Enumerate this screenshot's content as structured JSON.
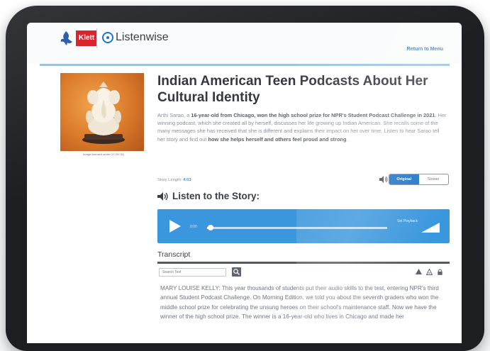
{
  "header": {
    "klett_logo_text": "Klett",
    "listenwise_logo_text": "Listenwise",
    "return_link": "Return to Menu"
  },
  "thumbnail": {
    "caption": "Image licensed under CC BY-SA"
  },
  "story": {
    "title": "Indian American Teen Podcasts About Her Cultural Identity",
    "body_parts": [
      "Arthi Sarao, a ",
      "16-year-old from Chicago, won the high school prize for NPR's Student Podcast Challenge in 2021",
      ". Her winning podcast, which she created all by herself, discusses her life growing up Indian American. She recalls some of the many messages she has received that she is different and explains their impact on her over time. Listen to hear Sarao tell her story and find out ",
      "how she helps herself and others feel proud and strong",
      "."
    ],
    "length_label": "Story Length: ",
    "length_value": "4:03"
  },
  "audio_toggle": {
    "options": [
      "Original",
      "Slower"
    ],
    "selected": "Original"
  },
  "listen": {
    "heading": "Listen to the Story:"
  },
  "player": {
    "current_time": "0:00",
    "speed_label": "Set Playback",
    "progress": 0.02
  },
  "transcript": {
    "heading": "Transcript",
    "search_placeholder": "Search Text",
    "text": "MARY LOUISE KELLY: This year thousands of students put their audio skills to the test, entering NPR's third annual Student Podcast Challenge. On Morning Edition, we told you about the seventh graders who won the middle school prize for celebrating the unsung heroes on their school's maintenance staff. Now we have the winner of the high school prize. The winner is a 16-year-old who lives in Chicago and made her"
  },
  "colors": {
    "accent_blue": "#1f74c7",
    "player_blue": "#3b97dd",
    "klett_red": "#d8262e",
    "tablet_frame": "#1d1e22"
  },
  "icons": [
    "klett-mark-icon",
    "listenwise-icon",
    "speaker-icon",
    "play-icon",
    "volume-icon",
    "search-icon",
    "print-icon",
    "font-size-icon",
    "lock-icon"
  ]
}
